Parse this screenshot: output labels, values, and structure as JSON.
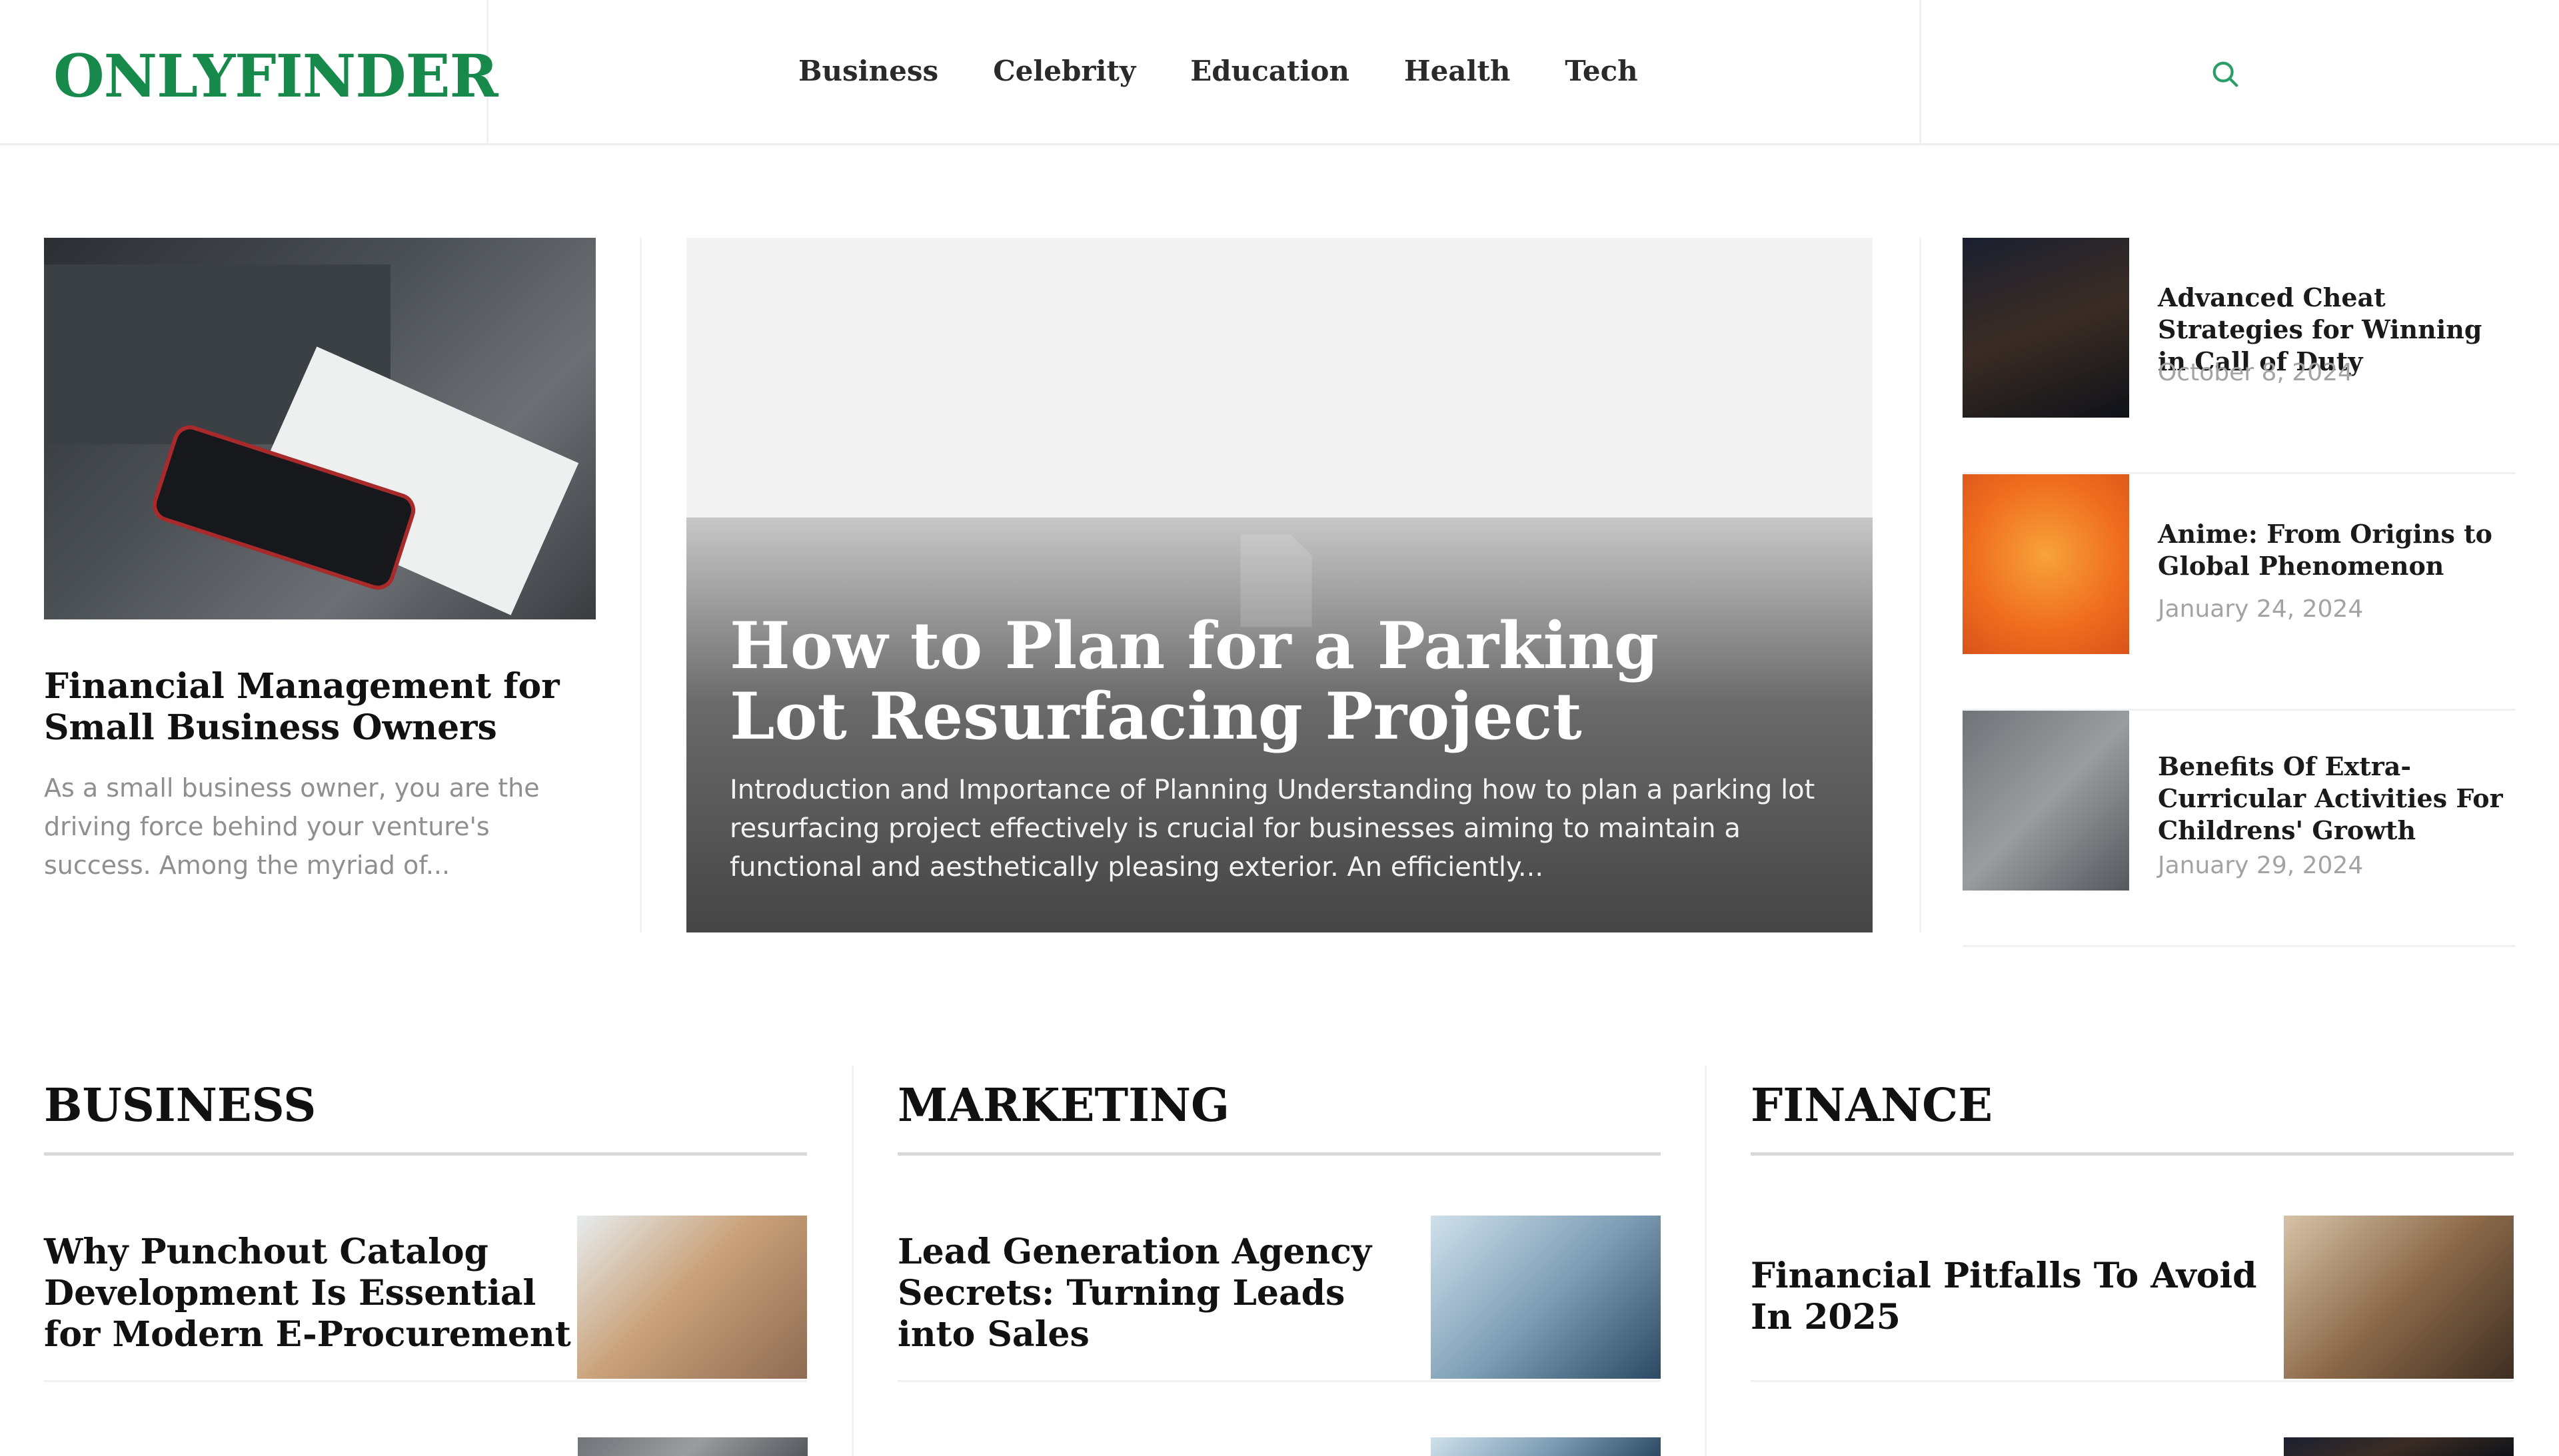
{
  "header": {
    "logo": "ONLYFINDER",
    "nav": [
      "Business",
      "Celebrity",
      "Education",
      "Health",
      "Tech"
    ],
    "search_icon": "search-icon"
  },
  "featured_left": {
    "title": "Financial Management for Small Business Owners",
    "excerpt": "As a small business owner, you are the driving force behind your venture's success. Among the myriad of..."
  },
  "hero": {
    "title": "How to Plan for a Parking Lot Resurfacing Project",
    "excerpt": "Introduction and Importance of Planning Understanding how to plan a parking lot resurfacing project effectively is crucial for businesses aiming to maintain a functional and aesthetically pleasing exterior. An efficiently..."
  },
  "right_list": [
    {
      "title": "Advanced Cheat Strategies for Winning in Call of Duty",
      "date": "October 8, 2024"
    },
    {
      "title": "Anime: From Origins to Global Phenomenon",
      "date": "January 24, 2024"
    },
    {
      "title": "Benefits Of Extra-Curricular Activities For Childrens' Growth",
      "date": "January 29, 2024"
    }
  ],
  "sections": [
    {
      "heading": "BUSINESS",
      "item_title": "Why Punchout Catalog Development Is Essential for Modern E-Procurement"
    },
    {
      "heading": "MARKETING",
      "item_title": "Lead Generation Agency Secrets: Turning Leads into Sales"
    },
    {
      "heading": "FINANCE",
      "item_title": "Financial Pitfalls To Avoid In 2025"
    }
  ],
  "colors": {
    "brand": "#178a4b",
    "accent_search": "#2a9d68"
  }
}
